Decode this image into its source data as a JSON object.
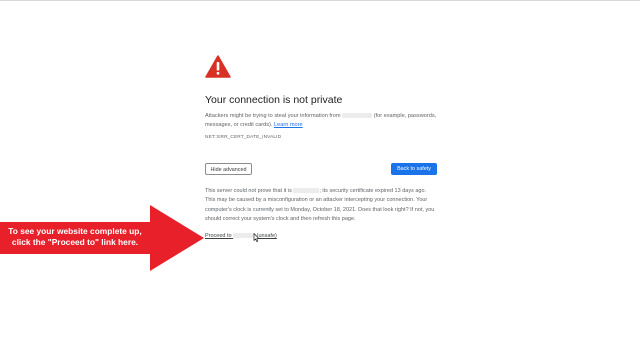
{
  "page": {
    "title": "Your connection is not private",
    "warning_text_before": "Attackers might be trying to steal your information from",
    "warning_text_after": "(for example, passwords, messages, or credit cards).",
    "learn_more_label": "Learn more",
    "error_code": "NET::ERR_CERT_DATE_INVALID",
    "hide_advanced_label": "Hide advanced",
    "back_to_safety_label": "Back to safety",
    "details_part1": "This server could not prove that it is",
    "details_part2": "; its security certificate expired 13 days ago. This may be caused by a misconfiguration or an attacker intercepting your connection. Your computer's clock is currently set to Monday, October 18, 2021. Does that look right? If not, you should correct your system's clock and then refresh this page.",
    "proceed_prefix": "Proceed to",
    "proceed_suffix": "(unsafe)"
  },
  "annotation": {
    "text_line1": "To see your website complete up,",
    "text_line2": "click the \"Proceed to\" link here."
  },
  "colors": {
    "warning_red": "#d93025",
    "link_blue": "#1a73e8",
    "primary_button": "#1a73e8",
    "annotation_arrow": "#e8202a"
  },
  "icons": {
    "warning": "warning-triangle-icon",
    "cursor": "mouse-cursor-icon"
  }
}
